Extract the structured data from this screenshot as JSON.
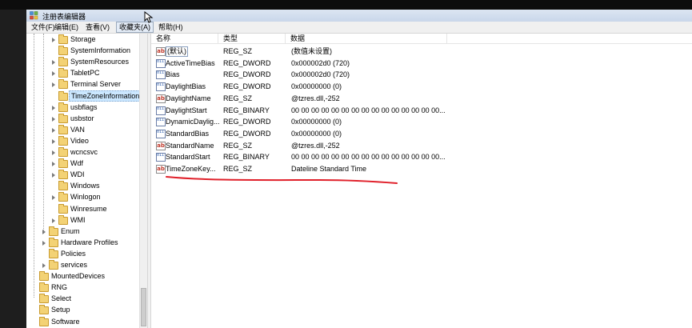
{
  "window": {
    "title": "注册表编辑器"
  },
  "menu": [
    {
      "label": "文件(F)",
      "active": false
    },
    {
      "label": "编辑(E)",
      "active": false
    },
    {
      "label": "查看(V)",
      "active": false
    },
    {
      "label": "收藏夹(A)",
      "active": true
    },
    {
      "label": "帮助(H)",
      "active": false
    }
  ],
  "tree": [
    {
      "label": "Storage",
      "level": 2,
      "expander": true
    },
    {
      "label": "SystemInformation",
      "level": 2,
      "expander": false
    },
    {
      "label": "SystemResources",
      "level": 2,
      "expander": true
    },
    {
      "label": "TabletPC",
      "level": 2,
      "expander": true
    },
    {
      "label": "Terminal Server",
      "level": 2,
      "expander": true
    },
    {
      "label": "TimeZoneInformation",
      "level": 2,
      "expander": false,
      "selected": true
    },
    {
      "label": "usbflags",
      "level": 2,
      "expander": true
    },
    {
      "label": "usbstor",
      "level": 2,
      "expander": true
    },
    {
      "label": "VAN",
      "level": 2,
      "expander": true
    },
    {
      "label": "Video",
      "level": 2,
      "expander": true
    },
    {
      "label": "wcncsvc",
      "level": 2,
      "expander": true
    },
    {
      "label": "Wdf",
      "level": 2,
      "expander": true
    },
    {
      "label": "WDI",
      "level": 2,
      "expander": true
    },
    {
      "label": "Windows",
      "level": 2,
      "expander": false
    },
    {
      "label": "Winlogon",
      "level": 2,
      "expander": true
    },
    {
      "label": "Winresume",
      "level": 2,
      "expander": false
    },
    {
      "label": "WMI",
      "level": 2,
      "expander": true
    },
    {
      "label": "Enum",
      "level": 1,
      "expander": true
    },
    {
      "label": "Hardware Profiles",
      "level": 1,
      "expander": true
    },
    {
      "label": "Policies",
      "level": 1,
      "expander": false
    },
    {
      "label": "services",
      "level": 1,
      "expander": true
    },
    {
      "label": "MountedDevices",
      "level": 0,
      "expander": false
    },
    {
      "label": "RNG",
      "level": 0,
      "expander": false
    },
    {
      "label": "Select",
      "level": 0,
      "expander": false
    },
    {
      "label": "Setup",
      "level": 0,
      "expander": false
    },
    {
      "label": "Software",
      "level": 0,
      "expander": false
    }
  ],
  "columns": {
    "name": "名称",
    "type": "类型",
    "data": "数据"
  },
  "values": [
    {
      "icon": "string",
      "name": "(默认)",
      "type": "REG_SZ",
      "data": "(数值未设置)",
      "default": true
    },
    {
      "icon": "binary",
      "name": "ActiveTimeBias",
      "type": "REG_DWORD",
      "data": "0x000002d0 (720)"
    },
    {
      "icon": "binary",
      "name": "Bias",
      "type": "REG_DWORD",
      "data": "0x000002d0 (720)"
    },
    {
      "icon": "binary",
      "name": "DaylightBias",
      "type": "REG_DWORD",
      "data": "0x00000000 (0)"
    },
    {
      "icon": "string",
      "name": "DaylightName",
      "type": "REG_SZ",
      "data": "@tzres.dll,-252"
    },
    {
      "icon": "binary",
      "name": "DaylightStart",
      "type": "REG_BINARY",
      "data": "00 00 00 00 00 00 00 00 00 00 00 00 00 00 00..."
    },
    {
      "icon": "binary",
      "name": "DynamicDaylig...",
      "type": "REG_DWORD",
      "data": "0x00000000 (0)"
    },
    {
      "icon": "binary",
      "name": "StandardBias",
      "type": "REG_DWORD",
      "data": "0x00000000 (0)"
    },
    {
      "icon": "string",
      "name": "StandardName",
      "type": "REG_SZ",
      "data": "@tzres.dll,-252"
    },
    {
      "icon": "binary",
      "name": "StandardStart",
      "type": "REG_BINARY",
      "data": "00 00 00 00 00 00 00 00 00 00 00 00 00 00 00..."
    },
    {
      "icon": "string",
      "name": "TimeZoneKey...",
      "type": "REG_SZ",
      "data": "Dateline Standard Time"
    }
  ],
  "colors": {
    "annotation": "#e0202a",
    "selection": "#cce8ff"
  },
  "icons": {
    "string_value": "ab",
    "binary_value": "011 110"
  }
}
